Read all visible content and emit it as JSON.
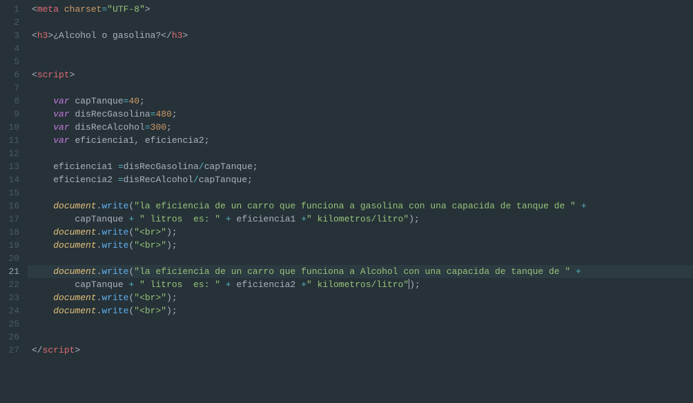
{
  "lineCount": 27,
  "activeLine": 21,
  "code": {
    "l1": {
      "tag": "meta",
      "attr": "charset",
      "val": "\"UTF-8\""
    },
    "l3": {
      "tag": "h3",
      "text": "¿Alcohol o gasolina?"
    },
    "l6": {
      "tag": "script"
    },
    "l8": {
      "kw": "var",
      "name": "capTanque",
      "val": "40"
    },
    "l9": {
      "kw": "var",
      "name": "disRecGasolina",
      "val": "480"
    },
    "l10": {
      "kw": "var",
      "name": "disRecAlcohol",
      "val": "300"
    },
    "l11": {
      "kw": "var",
      "name1": "eficiencia1",
      "name2": "eficiencia2"
    },
    "l13": {
      "lhs": "eficiencia1",
      "a": "disRecGasolina",
      "b": "capTanque"
    },
    "l14": {
      "lhs": "eficiencia2",
      "a": "disRecAlcohol",
      "b": "capTanque"
    },
    "l16": {
      "obj": "document",
      "method": "write",
      "s1": "\"la eficiencia de un carro que funciona a gasolina con una capacida de tanque de \"",
      "v1": "capTanque",
      "s2": "\" litros  es: \"",
      "v2": "eficiencia1",
      "s3": "\" kilometros/litro\""
    },
    "l18": {
      "obj": "document",
      "method": "write",
      "arg": "\"<br>\""
    },
    "l19": {
      "obj": "document",
      "method": "write",
      "arg": "\"<br>\""
    },
    "l21": {
      "obj": "document",
      "method": "write",
      "s1": "\"la eficiencia de un carro que funciona a Alcohol con una capacida de tanque de \"",
      "v1": "capTanque",
      "s2": "\" litros  es: \"",
      "v2": "eficiencia2",
      "s3": "\" kilometros/litro\""
    },
    "l23": {
      "obj": "document",
      "method": "write",
      "arg": "\"<br>\""
    },
    "l24": {
      "obj": "document",
      "method": "write",
      "arg": "\"<br>\""
    },
    "l27": {
      "tag": "script"
    }
  }
}
